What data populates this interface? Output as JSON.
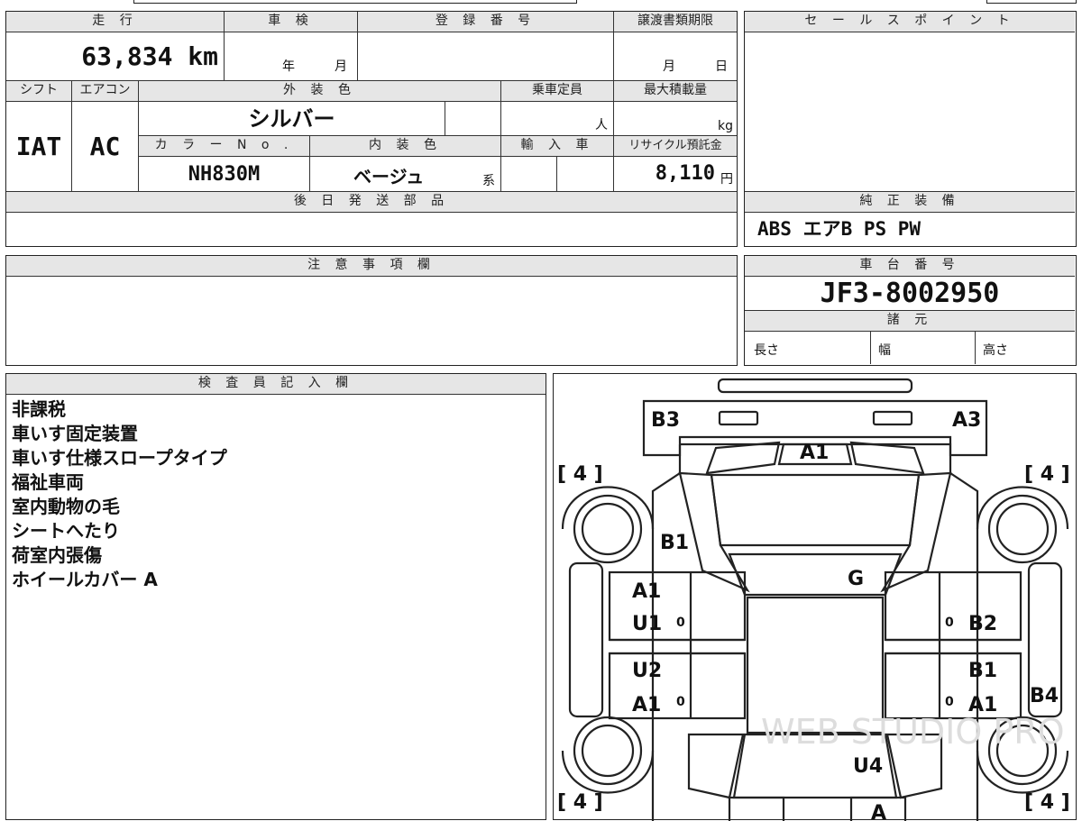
{
  "headers": {
    "mileage": "走 行",
    "inspection": "車 検",
    "registration_no": "登 録 番 号",
    "transfer_deadline": "譲渡書類期限",
    "sales_point": "セ ー ル ス ポ イ ン ト",
    "shift": "シフト",
    "aircon": "エアコン",
    "exterior_color": "外 装 色",
    "capacity": "乗車定員",
    "max_load": "最大積載量",
    "color_no": "カ ラ ー N o .",
    "interior_color": "内 装 色",
    "import": "輸 入 車",
    "recycle_fee": "リサイクル預託金",
    "later_parts": "後 日 発 送 部 品",
    "oem_equipment": "純 正 装 備",
    "caution": "注 意 事 項 欄",
    "chassis_no": "車 台 番 号",
    "specs": "諸 元",
    "inspector": "検 査 員 記 入 欄"
  },
  "vehicle": {
    "mileage": "63,834 km",
    "inspection_year": "年",
    "inspection_month": "月",
    "transfer_month": "月",
    "transfer_day": "日",
    "shift": "IAT",
    "aircon": "AC",
    "exterior_color": "シルバー",
    "capacity_unit": "人",
    "max_load_unit": "kg",
    "color_no": "NH830M",
    "interior_color": "ベージュ",
    "interior_suffix": "系",
    "recycle_fee": "8,110",
    "recycle_unit": "円",
    "equipment": "ABS  エアB  PS  PW",
    "chassis_no": "JF3-8002950",
    "spec_length": "長さ",
    "spec_width": "幅",
    "spec_height": "高さ"
  },
  "inspector_notes": [
    "非課税",
    "車いす固定装置",
    "車いす仕様スロープタイプ",
    "福祉車両",
    "室内動物の毛",
    "シートへたり",
    "荷室内張傷",
    "ホイールカバー A"
  ],
  "diagram": {
    "tire_left_top": "[ 4 ]",
    "tire_right_top": "[ 4 ]",
    "tire_left_bottom": "[ 4 ]",
    "tire_right_bottom": "[ 4 ]",
    "front_bumper_left": "B3",
    "front_bumper_right": "A3",
    "windshield": "A1",
    "left_fender": "B1",
    "roof": "G",
    "left_front_door": "A1",
    "left_front_door2": "U1",
    "left_rear_door": "U2",
    "left_rear_door2": "A1",
    "right_front_door": "B2",
    "right_rear_door": "B1",
    "right_rear_door2": "A1",
    "right_quarter": "B4",
    "rear_gate": "U4",
    "rear_bumper": "A",
    "zero_marks": [
      "0",
      "0",
      "0",
      "0"
    ],
    "watermark": "WEB STUDIO PRO"
  }
}
